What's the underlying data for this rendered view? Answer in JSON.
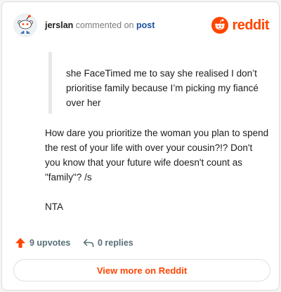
{
  "header": {
    "username": "jerslan",
    "action_text": "commented on",
    "post_link": "post",
    "brand_name": "reddit"
  },
  "quote": {
    "text": "she FaceTimed me to say she realised I don’t prioritise family because I’m picking my fiancé over her"
  },
  "comment": {
    "paragraphs": [
      "How dare you prioritize the woman you plan to spend the rest of your life with over your cousin?!? Don't you know that your future wife doesn't count as \"family\"? /s",
      "NTA"
    ]
  },
  "actions": {
    "upvotes_label": "9 upvotes",
    "replies_label": "0 replies"
  },
  "footer": {
    "view_more_label": "View more on Reddit"
  },
  "colors": {
    "brand": "#ff4500",
    "link": "#1a4fa3",
    "muted": "#576f76"
  },
  "icons": {
    "avatar": "snoo-avatar-icon",
    "brand": "reddit-logo-icon",
    "upvote": "upvote-arrow-icon",
    "reply": "reply-arrow-icon"
  }
}
